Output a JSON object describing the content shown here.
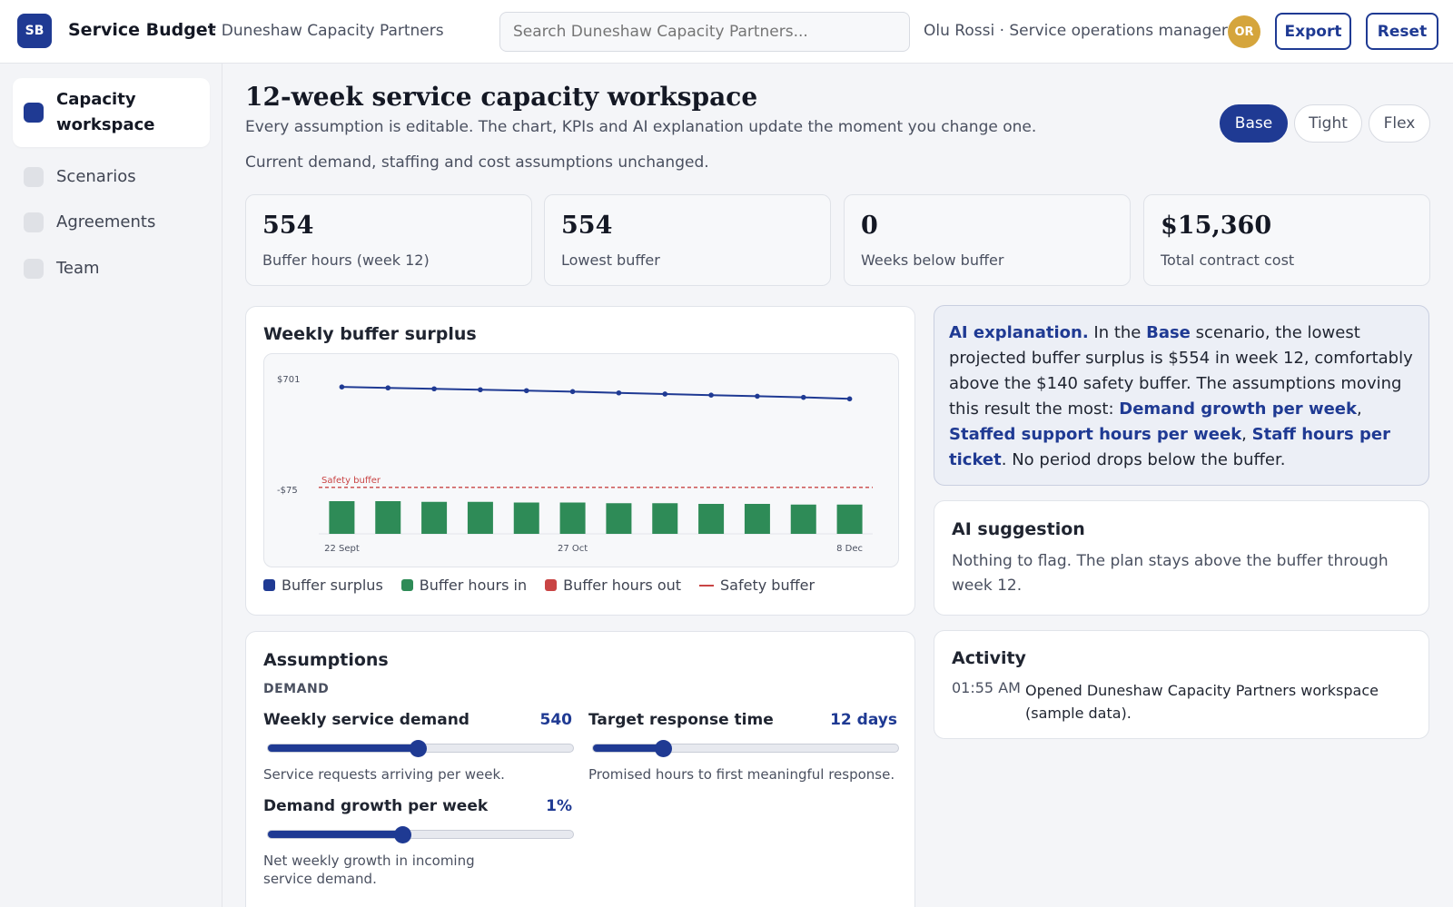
{
  "app": {
    "logo_text": "SB",
    "title": "Service Budget",
    "org": "· Duneshaw Capacity Partners",
    "search_placeholder": "Search Duneshaw Capacity Partners...",
    "user": "Olu Rossi · Service operations manager",
    "avatar_initials": "OR",
    "export_label": "Export",
    "reset_label": "Reset"
  },
  "sidebar": {
    "items": [
      {
        "label": "Capacity workspace",
        "active": true
      },
      {
        "label": "Scenarios",
        "active": false
      },
      {
        "label": "Agreements",
        "active": false
      },
      {
        "label": "Team",
        "active": false
      }
    ]
  },
  "page": {
    "title": "12-week service capacity workspace",
    "subtitle": "Every assumption is editable. The chart, KPIs and AI explanation update the moment you change one.",
    "status": "Current demand, staffing and cost assumptions unchanged.",
    "scenarios": [
      {
        "label": "Base",
        "active": true
      },
      {
        "label": "Tight",
        "active": false
      },
      {
        "label": "Flex",
        "active": false
      }
    ]
  },
  "kpis": [
    {
      "value": "554",
      "label": "Buffer hours (week 12)"
    },
    {
      "value": "554",
      "label": "Lowest buffer"
    },
    {
      "value": "0",
      "label": "Weeks below buffer"
    },
    {
      "value": "$15,360",
      "label": "Total contract cost"
    }
  ],
  "chart_card": {
    "title": "Weekly buffer surplus"
  },
  "chart_data": {
    "type": "bar",
    "y_tick_labels": [
      "$701",
      "-$75"
    ],
    "x_tick_labels": [
      "22 Sept",
      "27 Oct",
      "8 Dec"
    ],
    "x_tick_indices": [
      0,
      5,
      11
    ],
    "ylim": [
      -110,
      720
    ],
    "safety_buffer": 140,
    "safety_label": "Safety buffer",
    "series": [
      {
        "name": "Buffer surplus",
        "type": "line",
        "color": "#1f3a93",
        "values": [
          680,
          675,
          670,
          665,
          660,
          655,
          648,
          642,
          636,
          630,
          624,
          616
        ]
      },
      {
        "name": "Buffer hours in",
        "type": "bar",
        "color": "#2e8b57",
        "values": [
          -75,
          -75,
          -75,
          -75,
          -75,
          -75,
          -75,
          -75,
          -75,
          -75,
          -75,
          -75
        ],
        "bar_heights_hours": [
          48,
          48,
          47,
          47,
          46,
          46,
          45,
          45,
          44,
          44,
          43,
          43
        ]
      }
    ],
    "legend": [
      {
        "name": "Buffer surplus",
        "color": "#1f3a93",
        "kind": "swatch"
      },
      {
        "name": "Buffer hours in",
        "color": "#2e8b57",
        "kind": "swatch"
      },
      {
        "name": "Buffer hours out",
        "color": "#c94444",
        "kind": "swatch"
      },
      {
        "name": "Safety buffer",
        "color": "#c94444",
        "kind": "line"
      }
    ]
  },
  "ai_explanation": {
    "lead": "AI explanation.",
    "t1": " In the ",
    "scenario": "Base",
    "t2": " scenario, the lowest projected buffer surplus is $554 in week 12, comfortably above the $140 safety buffer. The assumptions moving this result the most: ",
    "d1": "Demand growth per week",
    "sep1": ", ",
    "d2": "Staffed support hours per week",
    "sep2": ", ",
    "d3": "Staff hours per ticket",
    "t3": ". No period drops below the buffer."
  },
  "ai_suggestion": {
    "title": "AI suggestion",
    "text": "Nothing to flag. The plan stays above the buffer through week 12."
  },
  "activity": {
    "title": "Activity",
    "items": [
      {
        "time": "01:55 AM",
        "text": "Opened Duneshaw Capacity Partners workspace (sample data)."
      }
    ]
  },
  "assumptions": {
    "title": "Assumptions",
    "section": "DEMAND",
    "sliders": [
      {
        "name": "Weekly service demand",
        "value": "540",
        "fraction": 0.49,
        "hint": "Service requests arriving per week."
      },
      {
        "name": "Target response time",
        "value": "12 days",
        "fraction": 0.23,
        "hint": "Promised hours to first meaningful response."
      },
      {
        "name": "Demand growth per week",
        "value": "1%",
        "fraction": 0.44,
        "hint": "Net weekly growth in incoming service demand."
      }
    ]
  }
}
